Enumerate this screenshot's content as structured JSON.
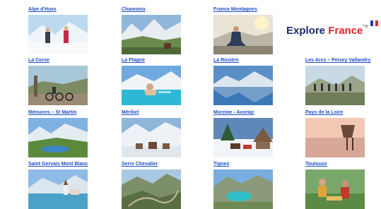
{
  "brand": {
    "name_part1": "Explore ",
    "name_part2": "France",
    "trademark": "TM",
    "colors": {
      "blue": "#1b2a6b",
      "red": "#e0242b",
      "link": "#1f4fc8"
    }
  },
  "destinations": [
    {
      "label": "Alpe d'Huez",
      "image": "skiers-snow"
    },
    {
      "label": "Chamonix",
      "image": "mountain-valley"
    },
    {
      "label": "France Montagnes",
      "image": "yoga-mountain"
    },
    {
      "label": "La Corse",
      "image": "cyclists-road"
    },
    {
      "label": "La Plagne",
      "image": "pool-mountain"
    },
    {
      "label": "La Rosière",
      "image": "lake-reflection"
    },
    {
      "label": "Les Arcs – Peisey Vallandry",
      "image": "hikers-ridge"
    },
    {
      "label": "Ménuires – St Martin",
      "image": "alpine-lake"
    },
    {
      "label": "Méribel",
      "image": "snow-village"
    },
    {
      "label": "Morzine - Avoriaz",
      "image": "horse-sleigh"
    },
    {
      "label": "Pays de la Loire",
      "image": "pier-sunset"
    },
    {
      "label": "Saint Gervais Mont Blanc",
      "image": "village-lake"
    },
    {
      "label": "Serre Chevalier",
      "image": "mountain-pass"
    },
    {
      "label": "Tignes",
      "image": "turquoise-lake"
    },
    {
      "label": "Toulouse",
      "image": "market-vendors"
    }
  ]
}
